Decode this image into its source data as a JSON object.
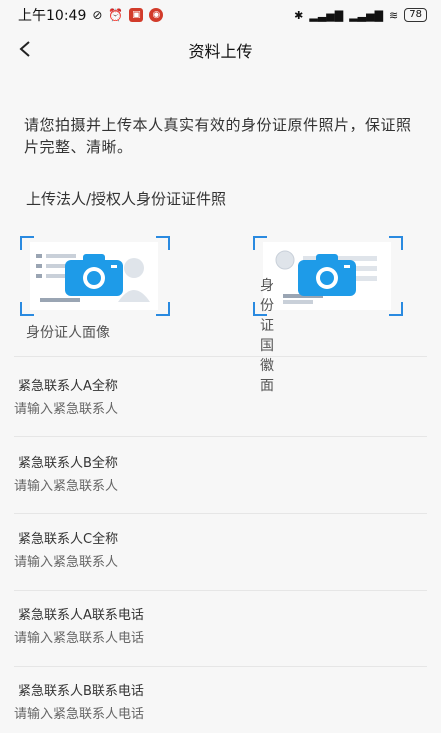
{
  "status": {
    "time": "上午10:49",
    "battery": "78"
  },
  "header": {
    "title": "资料上传"
  },
  "intro": "请您拍摄并上传本人真实有效的身份证原件照片，保证照片完整、清晰。",
  "section_title": "上传法人/授权人身份证证件照",
  "cards": {
    "front_label": "身份证人面像",
    "back_label": "身份证国徽面"
  },
  "fields": [
    {
      "label": "紧急联系人A全称",
      "placeholder": "请输入紧急联系人"
    },
    {
      "label": "紧急联系人B全称",
      "placeholder": "请输入紧急联系人"
    },
    {
      "label": "紧急联系人C全称",
      "placeholder": "请输入紧急联系人"
    },
    {
      "label": "紧急联系人A联系电话",
      "placeholder": "请输入紧急联系人电话"
    },
    {
      "label": "紧急联系人B联系电话",
      "placeholder": "请输入紧急联系人电话"
    }
  ],
  "colors": {
    "accent": "#2a8ae0",
    "camera_blue": "#1e9be8",
    "background": "#f7f7f7"
  }
}
